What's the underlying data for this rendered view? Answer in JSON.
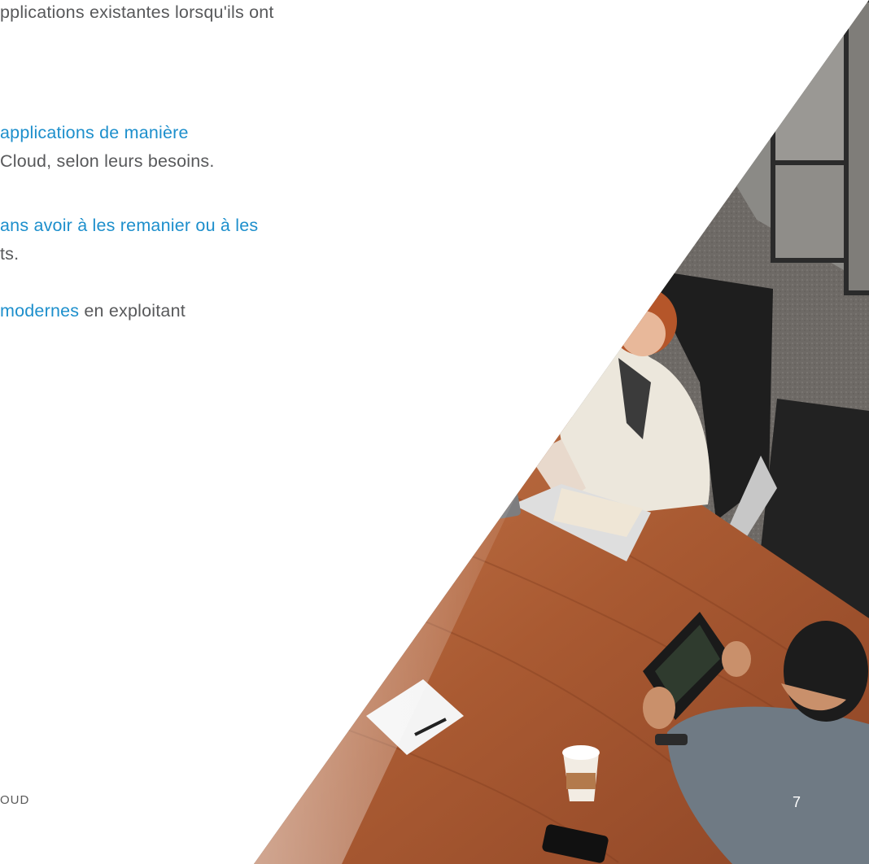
{
  "colors": {
    "body_text": "#58595b",
    "highlight": "#1d8fcc"
  },
  "paragraphs": {
    "p0_line1": "pplications existantes lorsqu'ils ont",
    "p1_line1_hl": "applications de manière",
    "p1_line2": "Cloud, selon leurs besoins.",
    "p2_line1_hl": "ans avoir à les remanier ou à les",
    "p2_line2": "ts.",
    "p3_line1_hl": "modernes",
    "p3_line1_rest": " en exploitant"
  },
  "footer": {
    "label": "OUD",
    "page_number": "7"
  },
  "photo": {
    "alt": "photo-meeting-table-laptops-tablet"
  }
}
